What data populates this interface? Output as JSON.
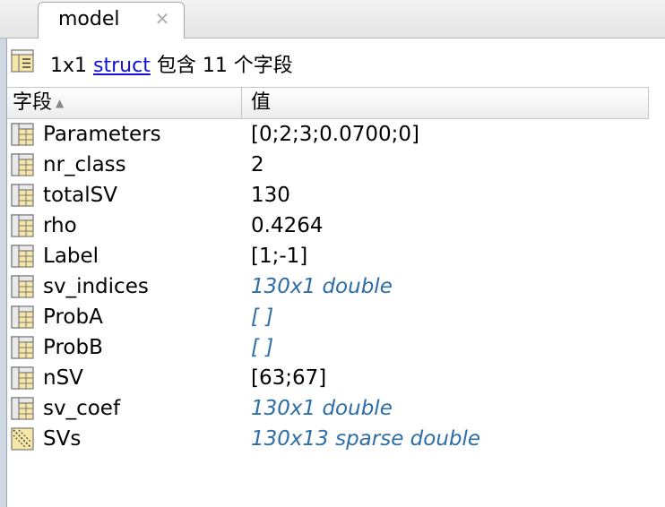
{
  "tab": {
    "label": "model",
    "close_glyph": "✕"
  },
  "info": {
    "prefix": "1x1",
    "link": "struct",
    "suffix": "包含 11 个字段"
  },
  "table": {
    "headers": {
      "field": "字段",
      "sort_glyph": "▲",
      "value": "值"
    },
    "rows": [
      {
        "name": "Parameters",
        "value": "[0;2;3;0.0700;0]",
        "style": "plain",
        "icon": "grid-icon"
      },
      {
        "name": "nr_class",
        "value": "2",
        "style": "plain",
        "icon": "grid-icon"
      },
      {
        "name": "totalSV",
        "value": "130",
        "style": "plain",
        "icon": "grid-icon"
      },
      {
        "name": "rho",
        "value": "0.4264",
        "style": "plain",
        "icon": "grid-icon"
      },
      {
        "name": "Label",
        "value": "[1;-1]",
        "style": "plain",
        "icon": "grid-icon"
      },
      {
        "name": "sv_indices",
        "value": "130x1 double",
        "style": "meta",
        "icon": "grid-icon"
      },
      {
        "name": "ProbA",
        "value": "[ ]",
        "style": "meta",
        "icon": "grid-icon"
      },
      {
        "name": "ProbB",
        "value": "[ ]",
        "style": "meta",
        "icon": "grid-icon"
      },
      {
        "name": "nSV",
        "value": "[63;67]",
        "style": "plain",
        "icon": "grid-icon"
      },
      {
        "name": "sv_coef",
        "value": "130x1 double",
        "style": "meta",
        "icon": "grid-icon"
      },
      {
        "name": "SVs",
        "value": "130x13 sparse double",
        "style": "meta",
        "icon": "sparse-icon"
      }
    ]
  }
}
